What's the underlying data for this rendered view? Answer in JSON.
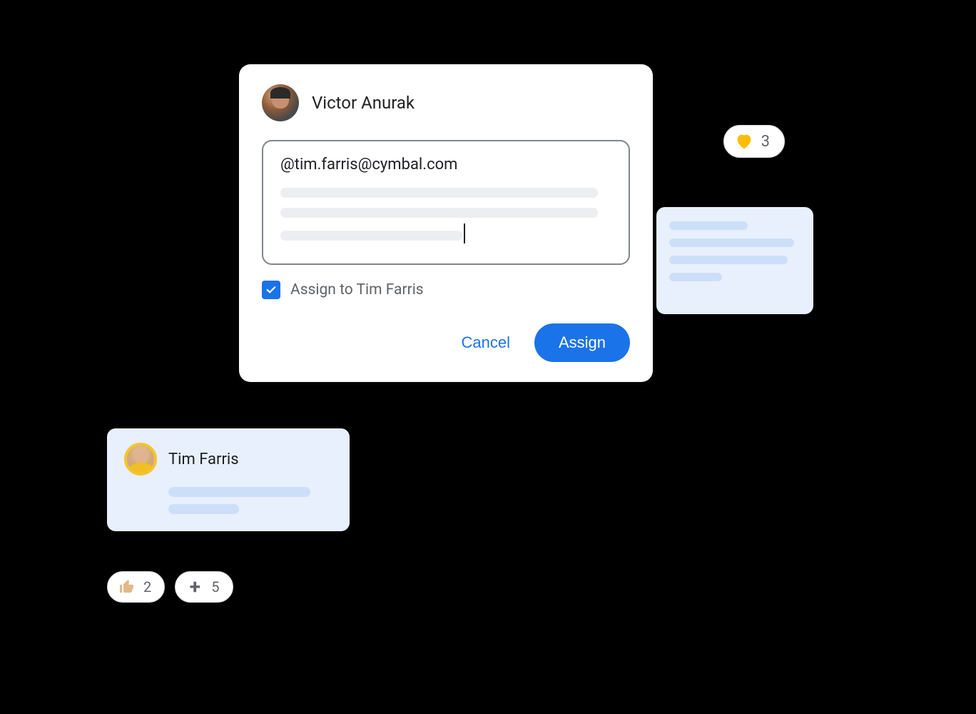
{
  "dialog": {
    "author_name": "Victor Anurak",
    "mention_text": "@tim.farris@cymbal.com",
    "assign_checked": true,
    "assign_label": "Assign to Tim Farris",
    "cancel_label": "Cancel",
    "assign_button_label": "Assign"
  },
  "user_card": {
    "name": "Tim Farris"
  },
  "reactions": {
    "heart": {
      "icon": "heart-icon",
      "count": "3"
    },
    "thumbs_up": {
      "icon": "thumbs-up-icon",
      "count": "2"
    },
    "plus": {
      "icon": "plus-icon",
      "count": "5"
    }
  }
}
